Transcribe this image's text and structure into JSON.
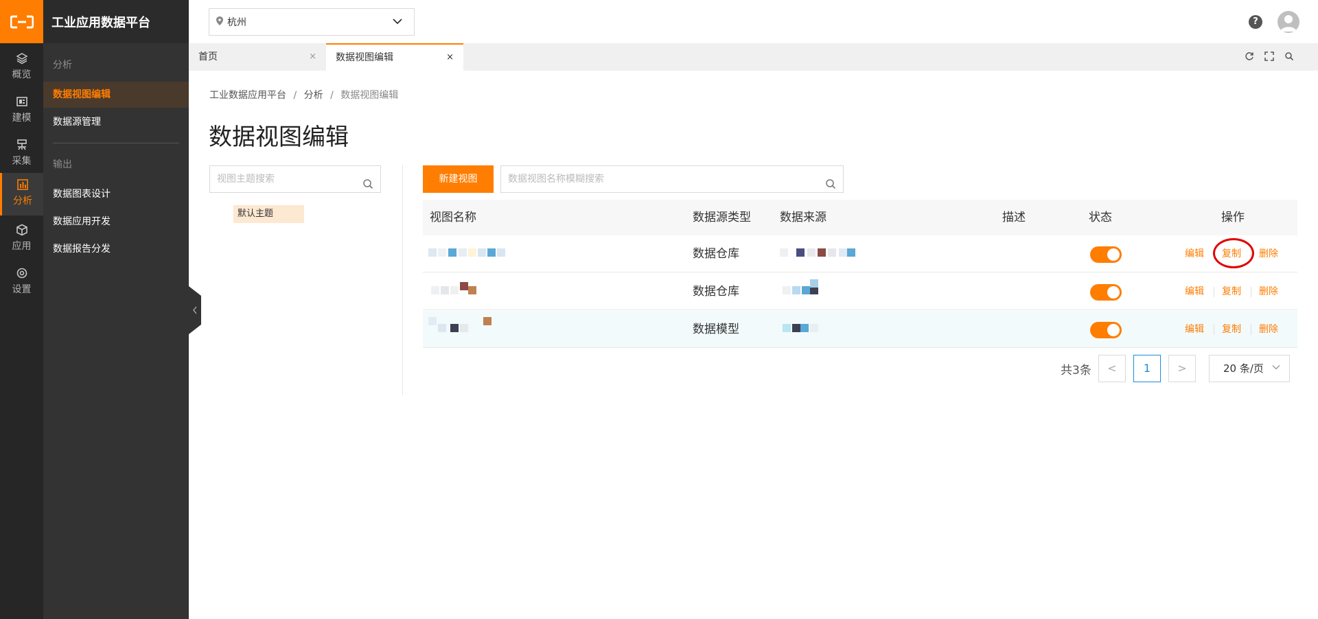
{
  "app": {
    "title": "工业应用数据平台",
    "logo_glyph": "[-]",
    "accent_color": "#ff7d00"
  },
  "rail": [
    {
      "label": "概览",
      "icon": "layers-icon",
      "glyph": "≋"
    },
    {
      "label": "建模",
      "icon": "model-icon",
      "glyph": "▣"
    },
    {
      "label": "采集",
      "icon": "collect-icon",
      "glyph": "⚲"
    },
    {
      "label": "分析",
      "icon": "analysis-icon",
      "glyph": "▥",
      "active": true
    },
    {
      "label": "应用",
      "icon": "cube-icon",
      "glyph": "⬡"
    },
    {
      "label": "设置",
      "icon": "gear-icon",
      "glyph": "◎"
    }
  ],
  "sidebar": {
    "group1": "分析",
    "group1_items": [
      "数据视图编辑",
      "数据源管理"
    ],
    "group2": "输出",
    "group2_items": [
      "数据图表设计",
      "数据应用开发",
      "数据报告分发"
    ]
  },
  "topbar": {
    "city": "杭州",
    "help_glyph": "?"
  },
  "tabs": [
    {
      "label": "首页",
      "close": "×"
    },
    {
      "label": "数据视图编辑",
      "close": "×",
      "active": true
    }
  ],
  "breadcrumb": {
    "root": "工业数据应用平台",
    "sep": "/",
    "mid": "分析",
    "current": "数据视图编辑"
  },
  "page_title": "数据视图编辑",
  "theme_search": {
    "placeholder": "视图主题搜索"
  },
  "theme_item": "默认主题",
  "new_view_button": "新建视图",
  "view_search": {
    "placeholder": "数据视图名称模糊搜索"
  },
  "table": {
    "headers": [
      "视图名称",
      "数据源类型",
      "数据来源",
      "描述",
      "状态",
      "操作"
    ],
    "rows": [
      {
        "type": "数据仓库",
        "enabled": true
      },
      {
        "type": "数据仓库",
        "enabled": true
      },
      {
        "type": "数据模型",
        "enabled": true
      }
    ],
    "actions": {
      "edit": "编辑",
      "copy": "复制",
      "delete": "删除"
    }
  },
  "pagination": {
    "total": "共3条",
    "prev": "<",
    "next": ">",
    "current_page": "1",
    "page_size": "20 条/页"
  }
}
